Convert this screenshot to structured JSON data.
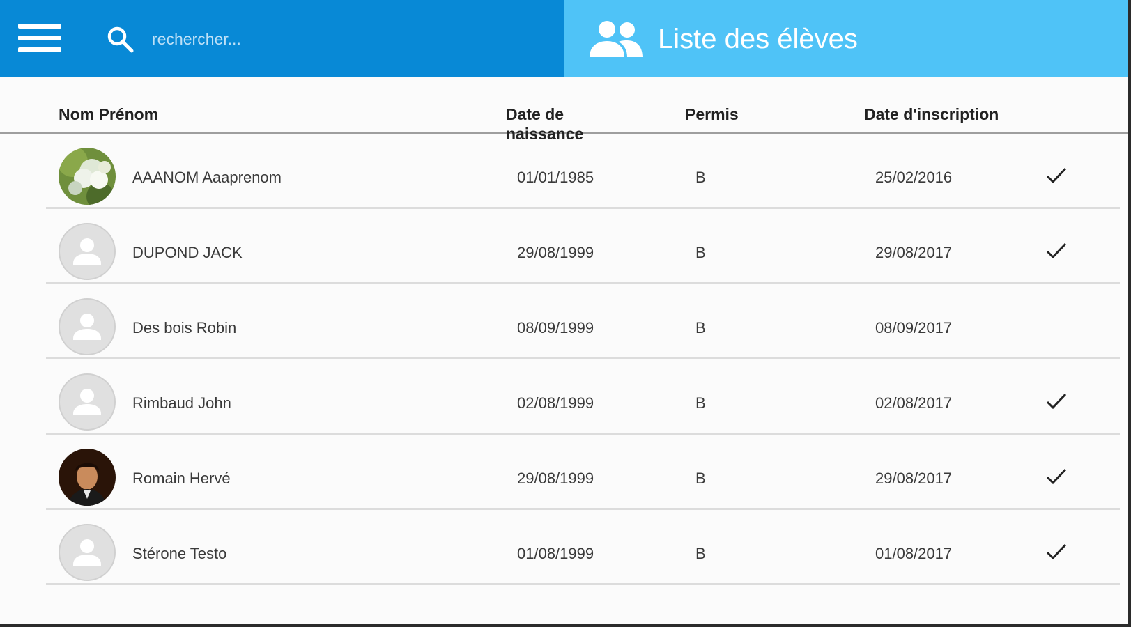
{
  "header": {
    "search_placeholder": "rechercher...",
    "title": "Liste des élèves"
  },
  "table": {
    "columns": [
      "Nom Prénom",
      "Date de naissance",
      "Permis",
      "Date d'inscription"
    ],
    "rows": [
      {
        "name": "AAANOM Aaaprenom",
        "birth": "01/01/1985",
        "permis": "B",
        "inscription": "25/02/2016",
        "checked": true,
        "avatar": "flowers-photo"
      },
      {
        "name": "DUPOND JACK",
        "birth": "29/08/1999",
        "permis": "B",
        "inscription": "29/08/2017",
        "checked": true,
        "avatar": "default-person"
      },
      {
        "name": "Des bois Robin",
        "birth": "08/09/1999",
        "permis": "B",
        "inscription": "08/09/2017",
        "checked": false,
        "avatar": "default-person"
      },
      {
        "name": "Rimbaud John",
        "birth": "02/08/1999",
        "permis": "B",
        "inscription": "02/08/2017",
        "checked": true,
        "avatar": "default-person"
      },
      {
        "name": "Romain Hervé",
        "birth": "29/08/1999",
        "permis": "B",
        "inscription": "29/08/2017",
        "checked": true,
        "avatar": "man-portrait-photo"
      },
      {
        "name": "Stérone Testo",
        "birth": "01/08/1999",
        "permis": "B",
        "inscription": "01/08/2017",
        "checked": true,
        "avatar": "default-person"
      }
    ]
  },
  "colors": {
    "bar_dark": "#0889d6",
    "bar_light": "#4fc3f7",
    "text": "#3a3a3a"
  }
}
